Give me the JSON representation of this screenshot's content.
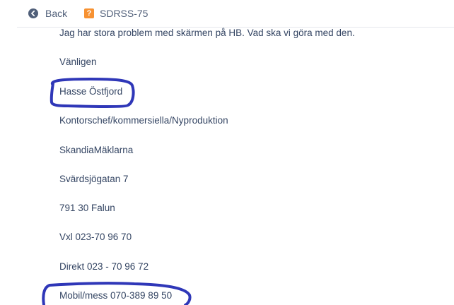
{
  "header": {
    "back_label": "Back",
    "back_icon": "arrow-left-circle-icon",
    "issue_icon": "question-mark-square-icon",
    "issue_icon_glyph": "?",
    "issue_key": "SDRSS-75"
  },
  "message": {
    "lines": [
      "Jag har stora problem med skärmen på HB. Vad ska vi göra med den.",
      "Vänligen",
      "Hasse Östfjord",
      "Kontorschef/kommersiella/Nyproduktion",
      "SkandiaMäklarna",
      "Svärdsjögatan 7",
      "791 30 Falun",
      "Vxl 023-70 96 70",
      "Direkt 023 - 70 96 72",
      "Mobil/mess 070-389 89 50"
    ]
  },
  "colors": {
    "annotation_ink": "#2f37b8",
    "issue_icon_bg": "#f79232",
    "text": "#344563"
  }
}
